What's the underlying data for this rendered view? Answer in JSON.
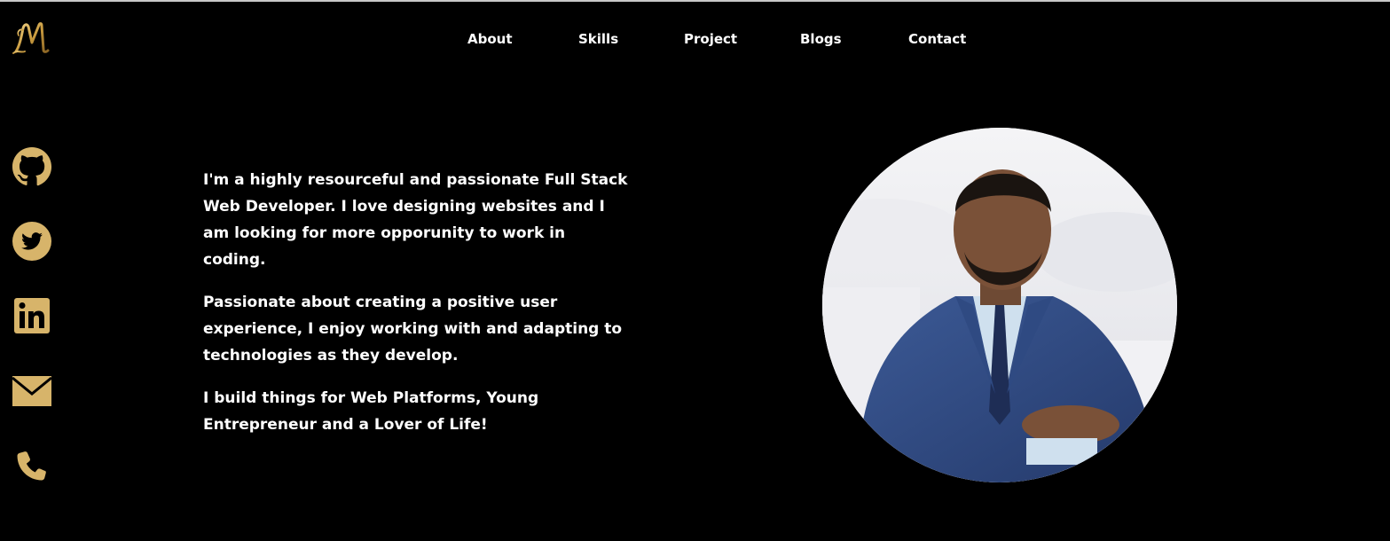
{
  "logo": {
    "icon": "monogram-m-logo",
    "color": "#d9b56a"
  },
  "nav": {
    "items": [
      {
        "label": "About"
      },
      {
        "label": "Skills"
      },
      {
        "label": "Project"
      },
      {
        "label": "Blogs"
      },
      {
        "label": "Contact"
      }
    ]
  },
  "social": {
    "color": "#d7b46a",
    "items": [
      {
        "icon": "github-icon"
      },
      {
        "icon": "twitter-icon"
      },
      {
        "icon": "linkedin-icon"
      },
      {
        "icon": "email-icon"
      },
      {
        "icon": "phone-icon"
      }
    ]
  },
  "bio": {
    "paragraphs": [
      "I'm a highly resourceful and passionate Full Stack Web Developer. I love designing websites and I am looking for more opporunity to work in coding.",
      "Passionate about creating a positive user experience, I enjoy working with and adapting to technologies as they develop.",
      "I build things for Web Platforms, Young Entrepreneur and a Lover of Life!"
    ]
  },
  "portrait": {
    "subject": "profile-photo"
  }
}
